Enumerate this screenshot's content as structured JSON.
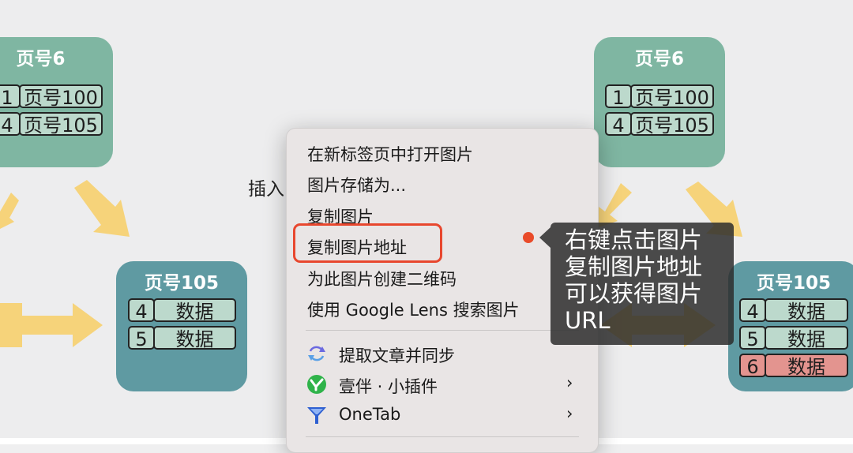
{
  "diagram": {
    "left_top_page": {
      "title": "页号6",
      "rows": [
        {
          "key": "1",
          "value": "页号100"
        },
        {
          "key": "4",
          "value": "页号105"
        }
      ]
    },
    "left_bottom_page": {
      "title": "页号105",
      "rows": [
        {
          "key": "4",
          "value": "数据"
        },
        {
          "key": "5",
          "value": "数据"
        }
      ]
    },
    "right_top_page": {
      "title": "页号6",
      "rows": [
        {
          "key": "1",
          "value": "页号100"
        },
        {
          "key": "4",
          "value": "页号105"
        }
      ]
    },
    "right_bottom_page": {
      "title": "页号105",
      "rows": [
        {
          "key": "4",
          "value": "数据"
        },
        {
          "key": "5",
          "value": "数据"
        },
        {
          "key": "6",
          "value": "数据"
        }
      ]
    },
    "caption_partial": "插入",
    "colors": {
      "page_top": "#7fb6a2",
      "page_bottom": "#5f9aa2",
      "cell": "#bcd9cc",
      "cell_new": "#e3948f",
      "arrow": "#f6d37a"
    }
  },
  "context_menu": {
    "items": [
      {
        "label": "在新标签页中打开图片"
      },
      {
        "label": "图片存储为..."
      },
      {
        "label": "复制图片"
      },
      {
        "label": "复制图片地址"
      },
      {
        "label": "为此图片创建二维码"
      },
      {
        "label": "使用 Google Lens 搜索图片"
      }
    ],
    "extensions": [
      {
        "label": "提取文章并同步",
        "icon": "sync-arrows-icon"
      },
      {
        "label": "壹伴 · 小插件",
        "icon": "yiban-logo-icon",
        "has_submenu": true
      },
      {
        "label": "OneTab",
        "icon": "onetab-funnel-icon",
        "has_submenu": true
      }
    ],
    "submenu_glyph": "›"
  },
  "annotation": {
    "lines": [
      "右键点击图片",
      "复制图片地址",
      "可以获得图片",
      "URL"
    ],
    "highlight_color": "#e8472e"
  }
}
